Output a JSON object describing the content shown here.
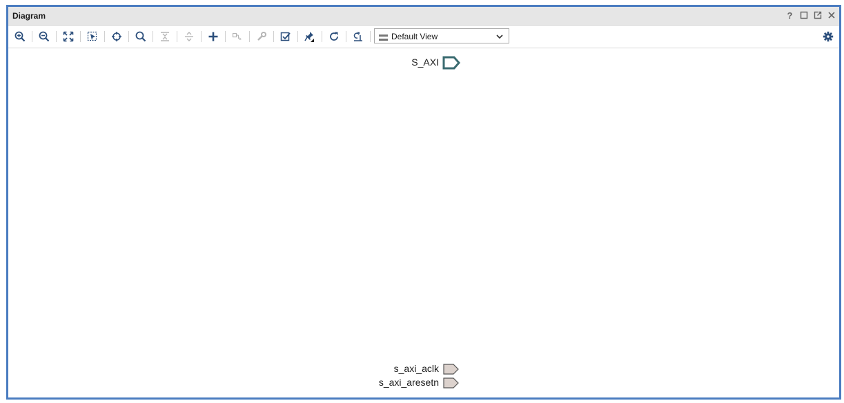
{
  "window": {
    "title": "Diagram",
    "controls": [
      {
        "name": "help-icon",
        "glyph": "?"
      },
      {
        "name": "maximize-icon"
      },
      {
        "name": "float-icon"
      },
      {
        "name": "close-icon"
      }
    ]
  },
  "toolbar": {
    "buttons": [
      {
        "name": "zoom-in-icon",
        "enabled": true
      },
      {
        "name": "zoom-out-icon",
        "enabled": true
      },
      {
        "name": "zoom-fit-icon",
        "enabled": true
      },
      {
        "name": "zoom-selection-icon",
        "enabled": true
      },
      {
        "name": "crosshair-icon",
        "enabled": true
      },
      {
        "name": "search-icon",
        "enabled": true
      },
      {
        "name": "collapse-all-icon",
        "enabled": false
      },
      {
        "name": "expand-all-icon",
        "enabled": false
      },
      {
        "name": "add-ip-icon",
        "enabled": true
      },
      {
        "name": "make-connection-icon",
        "enabled": false
      },
      {
        "name": "wrench-icon",
        "enabled": false
      },
      {
        "name": "validate-design-icon",
        "enabled": true
      },
      {
        "name": "pin-icon",
        "enabled": true
      },
      {
        "name": "refresh-icon",
        "enabled": true
      },
      {
        "name": "regenerate-layout-icon",
        "enabled": true
      }
    ],
    "view_select": {
      "value": "Default View"
    },
    "settings": {
      "name": "gear-icon"
    }
  },
  "ports": {
    "s_axi": {
      "label": "S_AXI",
      "type": "interface"
    },
    "s_axi_aclk": {
      "label": "s_axi_aclk",
      "type": "clock"
    },
    "s_axi_aresetn": {
      "label": "s_axi_aresetn",
      "type": "reset"
    }
  },
  "colors": {
    "frame_border": "#4a7cc0",
    "icon": "#2c4f7c",
    "icon_disabled": "#b5b5b5",
    "interface_port": "#3a6b70",
    "signal_port_fill": "#dcd2cd"
  }
}
